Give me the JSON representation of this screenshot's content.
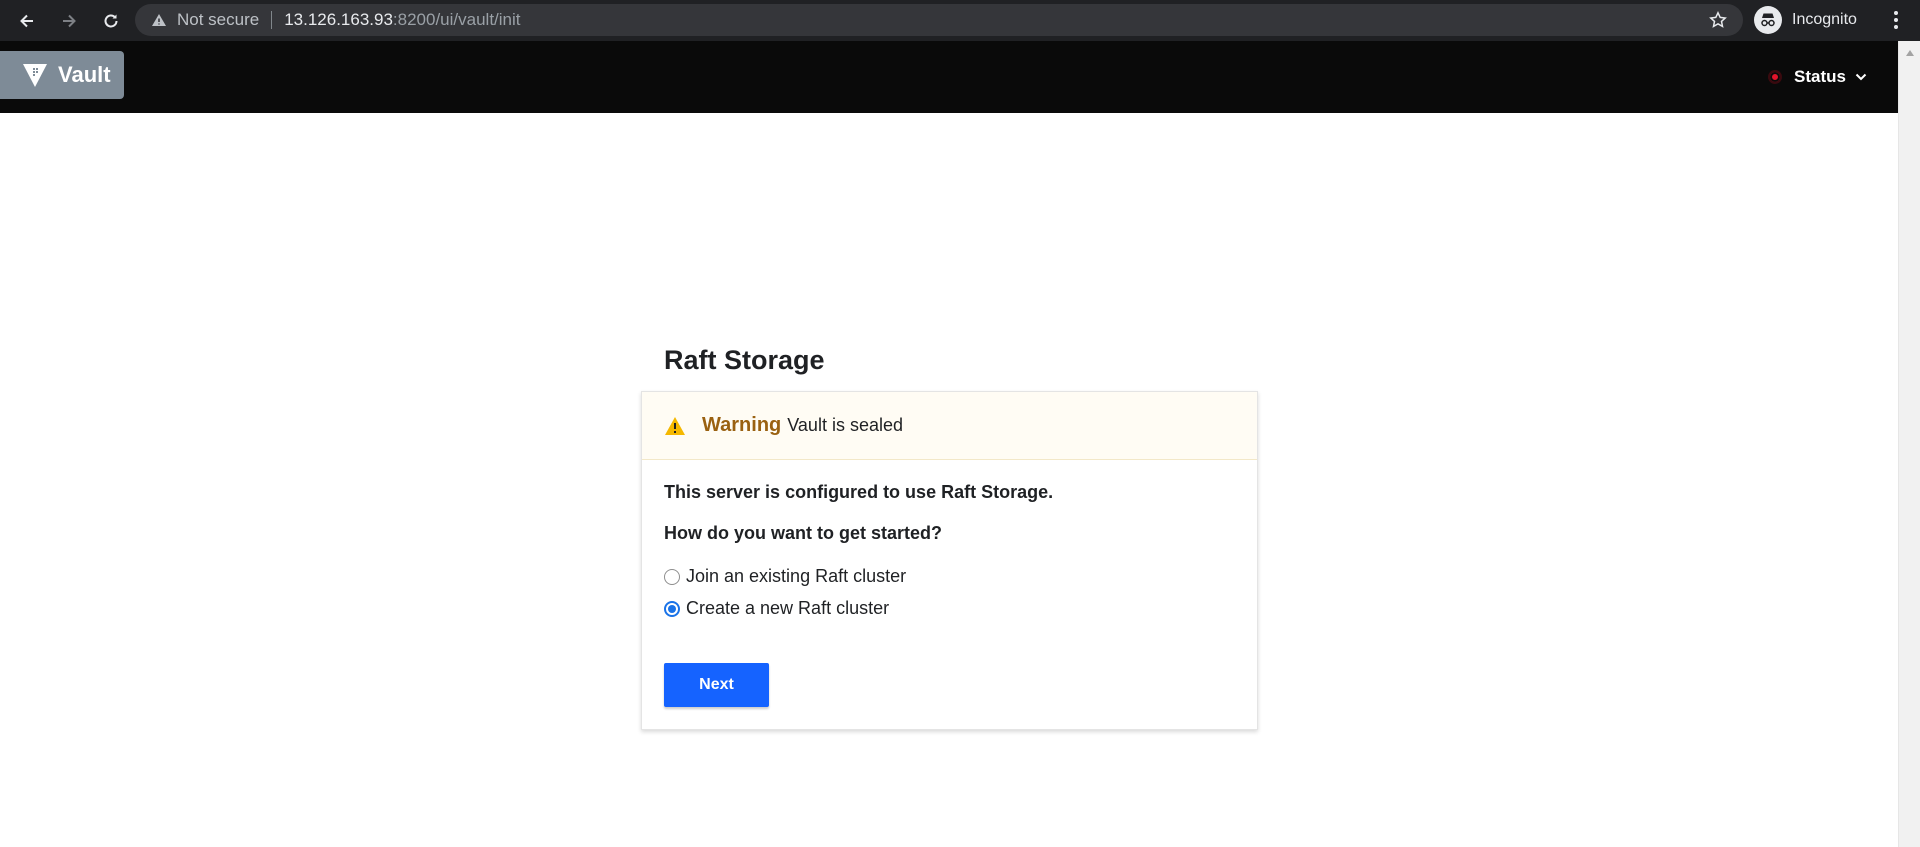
{
  "browser": {
    "not_secure_label": "Not secure",
    "url_host": "13.126.163.93",
    "url_rest": ":8200/ui/vault/init",
    "incognito_label": "Incognito"
  },
  "header": {
    "logo_text": "Vault",
    "status_label": "Status",
    "status_color": "#e0142b"
  },
  "main": {
    "title": "Raft Storage",
    "alert": {
      "title": "Warning",
      "message": "Vault is sealed",
      "color": "#9a6111"
    },
    "description": "This server is configured to use Raft Storage.",
    "question": "How do you want to get started?",
    "options": [
      {
        "label": "Join an existing Raft cluster",
        "selected": false
      },
      {
        "label": "Create a new Raft cluster",
        "selected": true
      }
    ],
    "next_button": "Next",
    "accent_color": "#1563ff"
  }
}
